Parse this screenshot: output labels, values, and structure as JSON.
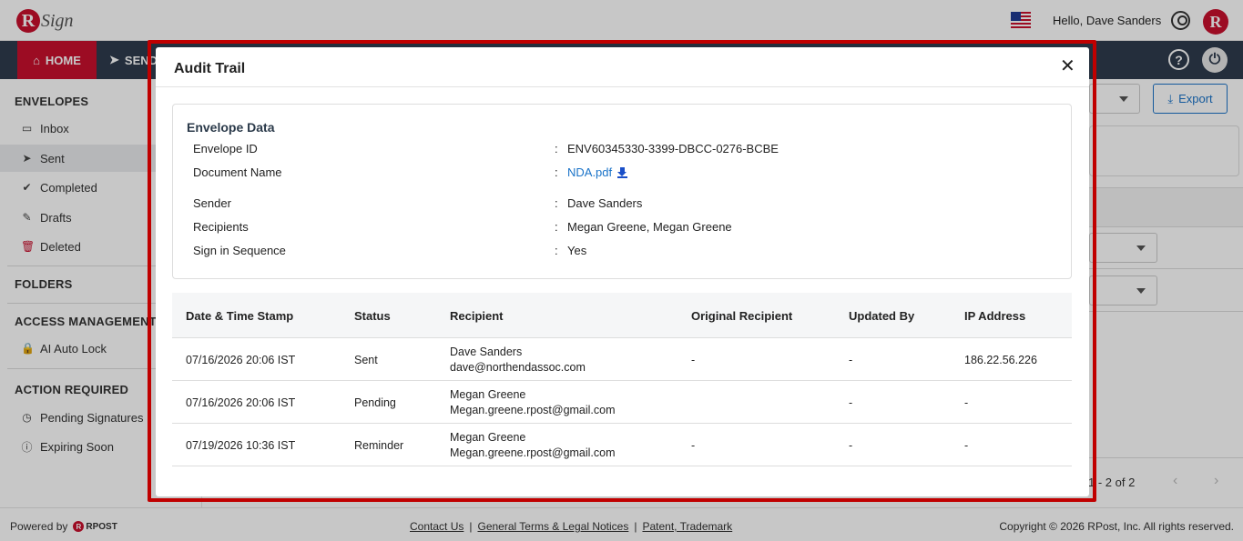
{
  "header": {
    "logo_text": "Sign",
    "logo_letter": "R",
    "greeting": "Hello, Dave Sanders"
  },
  "nav": {
    "home_label": "HOME",
    "send_label": "SEND"
  },
  "sidebar": {
    "envelopes_title": "ENVELOPES",
    "envelopes": [
      {
        "label": "Inbox"
      },
      {
        "label": "Sent"
      },
      {
        "label": "Completed"
      },
      {
        "label": "Drafts"
      },
      {
        "label": "Deleted"
      }
    ],
    "folders_title": "FOLDERS",
    "access_title": "ACCESS MANAGEMENT",
    "access_items": [
      {
        "label": "AI Auto Lock"
      }
    ],
    "action_title": "ACTION REQUIRED",
    "action_items": [
      {
        "label": "Pending Signatures"
      },
      {
        "label": "Expiring Soon"
      }
    ]
  },
  "main": {
    "export_label": "Export",
    "pager_text": "1 - 2 of 2"
  },
  "footer": {
    "powered_by": "Powered by",
    "rpost": "RPOST",
    "links": [
      "Contact Us",
      "General Terms & Legal Notices",
      "Patent, Trademark"
    ],
    "separator": "|",
    "copyright": "Copyright © 2026 RPost, Inc. All rights reserved."
  },
  "modal": {
    "title": "Audit Trail",
    "close": "✕",
    "envelope": {
      "title": "Envelope Data",
      "colon": ":",
      "rows": [
        {
          "label": "Envelope ID",
          "value": "ENV60345330-3399-DBCC-0276-BCBE"
        },
        {
          "label": "Document Name",
          "value": "NDA.pdf"
        },
        {
          "label": "Sender",
          "value": "Dave Sanders"
        },
        {
          "label": "Recipients",
          "value": "Megan Greene, Megan Greene"
        },
        {
          "label": "Sign in Sequence",
          "value": "Yes"
        }
      ]
    },
    "table": {
      "headers": [
        "Date & Time Stamp",
        "Status",
        "Recipient",
        "Original Recipient",
        "Updated By",
        "IP Address"
      ],
      "rows": [
        {
          "date": "07/16/2026 20:06 IST",
          "status": "Sent",
          "recipient_name": "Dave Sanders",
          "recipient_email": "dave@northendassoc.com",
          "original": "-",
          "updated_by": "-",
          "ip": "186.22.56.226"
        },
        {
          "date": "07/16/2026 20:06 IST",
          "status": "Pending",
          "recipient_name": "Megan Greene",
          "recipient_email": "Megan.greene.rpost@gmail.com",
          "original": "",
          "updated_by": "-",
          "ip": "-"
        },
        {
          "date": "07/19/2026 10:36 IST",
          "status": "Reminder",
          "recipient_name": "Megan Greene",
          "recipient_email": "Megan.greene.rpost@gmail.com",
          "original": "-",
          "updated_by": "-",
          "ip": "-"
        }
      ]
    }
  }
}
